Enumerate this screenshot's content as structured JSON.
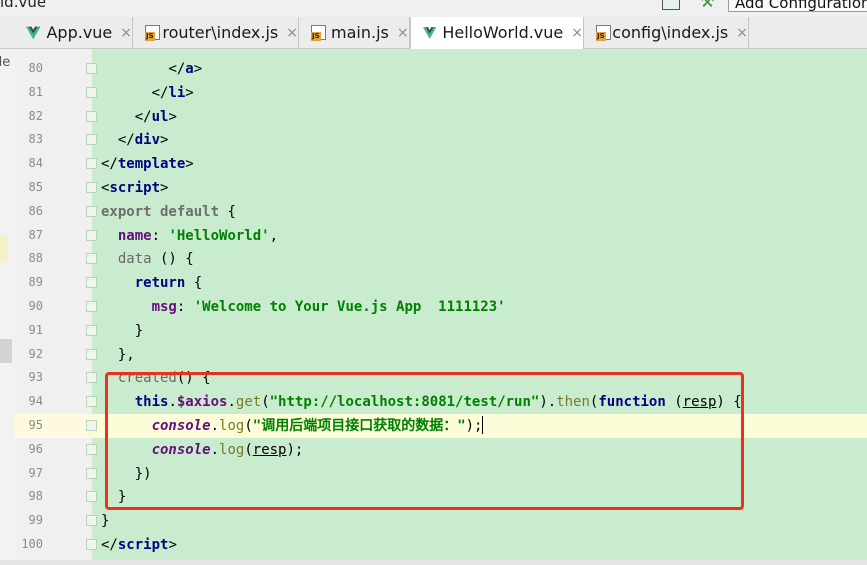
{
  "topbar": {
    "current_file": "ld.vue",
    "config_label": "Add Configuration"
  },
  "tabs": [
    {
      "label": "App.vue",
      "icon": "vue-icon",
      "active": false
    },
    {
      "label": "router\\index.js",
      "icon": "js-file-icon",
      "active": false
    },
    {
      "label": "main.js",
      "icon": "js-file-icon",
      "active": false
    },
    {
      "label": "HelloWorld.vue",
      "icon": "vue-icon",
      "active": true
    },
    {
      "label": "config\\index.js",
      "icon": "js-file-icon",
      "active": false
    }
  ],
  "close_glyph": "×",
  "side_panel_text": "de",
  "editor": {
    "background_color": "#c9ebce",
    "current_line": 95,
    "lines": [
      {
        "n": "80",
        "tokens": [
          {
            "t": "        ",
            "c": "plain"
          },
          {
            "t": "</",
            "c": "br"
          },
          {
            "t": "a",
            "c": "tag"
          },
          {
            "t": ">",
            "c": "br"
          }
        ]
      },
      {
        "n": "81",
        "tokens": [
          {
            "t": "      ",
            "c": "plain"
          },
          {
            "t": "</",
            "c": "br"
          },
          {
            "t": "li",
            "c": "tag"
          },
          {
            "t": ">",
            "c": "br"
          }
        ]
      },
      {
        "n": "82",
        "tokens": [
          {
            "t": "    ",
            "c": "plain"
          },
          {
            "t": "</",
            "c": "br"
          },
          {
            "t": "ul",
            "c": "tag"
          },
          {
            "t": ">",
            "c": "br"
          }
        ]
      },
      {
        "n": "83",
        "tokens": [
          {
            "t": "  ",
            "c": "plain"
          },
          {
            "t": "</",
            "c": "br"
          },
          {
            "t": "div",
            "c": "tag"
          },
          {
            "t": ">",
            "c": "br"
          }
        ]
      },
      {
        "n": "84",
        "tokens": [
          {
            "t": "</",
            "c": "br"
          },
          {
            "t": "template",
            "c": "tag"
          },
          {
            "t": ">",
            "c": "br"
          }
        ]
      },
      {
        "n": "85",
        "tokens": [
          {
            "t": "<",
            "c": "br"
          },
          {
            "t": "script",
            "c": "tag"
          },
          {
            "t": ">",
            "c": "br"
          }
        ]
      },
      {
        "n": "86",
        "tokens": [
          {
            "t": "export default",
            "c": "kwd"
          },
          {
            "t": " {",
            "c": "plain"
          }
        ]
      },
      {
        "n": "87",
        "tokens": [
          {
            "t": "  ",
            "c": "plain"
          },
          {
            "t": "name",
            "c": "prop"
          },
          {
            "t": ": ",
            "c": "plain"
          },
          {
            "t": "'HelloWorld'",
            "c": "str"
          },
          {
            "t": ",",
            "c": "plain"
          }
        ]
      },
      {
        "n": "88",
        "tokens": [
          {
            "t": "  ",
            "c": "plain"
          },
          {
            "t": "data",
            "c": "fn"
          },
          {
            "t": " () {",
            "c": "plain"
          }
        ]
      },
      {
        "n": "89",
        "tokens": [
          {
            "t": "    ",
            "c": "plain"
          },
          {
            "t": "return",
            "c": "kw"
          },
          {
            "t": " {",
            "c": "plain"
          }
        ]
      },
      {
        "n": "90",
        "tokens": [
          {
            "t": "      ",
            "c": "plain"
          },
          {
            "t": "msg",
            "c": "prop"
          },
          {
            "t": ": ",
            "c": "plain"
          },
          {
            "t": "'Welcome to Your Vue.js App  1111123'",
            "c": "str"
          }
        ]
      },
      {
        "n": "91",
        "tokens": [
          {
            "t": "    }",
            "c": "plain"
          }
        ]
      },
      {
        "n": "92",
        "tokens": [
          {
            "t": "  },",
            "c": "plain"
          }
        ]
      },
      {
        "n": "93",
        "tokens": [
          {
            "t": "  ",
            "c": "plain"
          },
          {
            "t": "created",
            "c": "fn"
          },
          {
            "t": "() {",
            "c": "plain"
          }
        ]
      },
      {
        "n": "94",
        "tokens": [
          {
            "t": "    ",
            "c": "plain"
          },
          {
            "t": "this",
            "c": "kw"
          },
          {
            "t": ".",
            "c": "plain"
          },
          {
            "t": "$axios",
            "c": "prop"
          },
          {
            "t": ".",
            "c": "plain"
          },
          {
            "t": "get",
            "c": "meth"
          },
          {
            "t": "(",
            "c": "plain"
          },
          {
            "t": "\"http://localhost:8081/test/run\"",
            "c": "str"
          },
          {
            "t": ").",
            "c": "plain"
          },
          {
            "t": "then",
            "c": "meth"
          },
          {
            "t": "(",
            "c": "plain"
          },
          {
            "t": "function",
            "c": "kw"
          },
          {
            "t": " (",
            "c": "plain"
          },
          {
            "t": "resp",
            "c": "param"
          },
          {
            "t": ") {",
            "c": "plain"
          }
        ]
      },
      {
        "n": "95",
        "tokens": [
          {
            "t": "      ",
            "c": "plain"
          },
          {
            "t": "console",
            "c": "ital"
          },
          {
            "t": ".",
            "c": "plain"
          },
          {
            "t": "log",
            "c": "meth"
          },
          {
            "t": "(",
            "c": "plain"
          },
          {
            "t": "\"调用后端项目接口获取的数据：\"",
            "c": "str"
          },
          {
            "t": ");",
            "c": "plain"
          }
        ]
      },
      {
        "n": "96",
        "tokens": [
          {
            "t": "      ",
            "c": "plain"
          },
          {
            "t": "console",
            "c": "ital"
          },
          {
            "t": ".",
            "c": "plain"
          },
          {
            "t": "log",
            "c": "meth"
          },
          {
            "t": "(",
            "c": "plain"
          },
          {
            "t": "resp",
            "c": "param"
          },
          {
            "t": ");",
            "c": "plain"
          }
        ]
      },
      {
        "n": "97",
        "tokens": [
          {
            "t": "    })",
            "c": "plain"
          }
        ]
      },
      {
        "n": "98",
        "tokens": [
          {
            "t": "  }",
            "c": "plain"
          }
        ]
      },
      {
        "n": "99",
        "tokens": [
          {
            "t": "}",
            "c": "plain"
          }
        ]
      },
      {
        "n": "100",
        "tokens": [
          {
            "t": "</",
            "c": "br"
          },
          {
            "t": "script",
            "c": "tag"
          },
          {
            "t": ">",
            "c": "br"
          }
        ]
      }
    ]
  },
  "annotation_color": "#e8321f"
}
